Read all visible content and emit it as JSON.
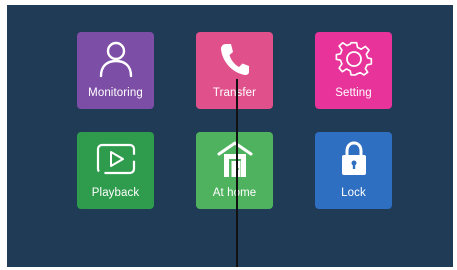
{
  "tiles": {
    "monitoring": {
      "label": "Monitoring",
      "icon": "person-icon",
      "color": "#7d4ea6"
    },
    "transfer": {
      "label": "Transfer",
      "icon": "phone-icon",
      "color": "#e0518c"
    },
    "setting": {
      "label": "Setting",
      "icon": "gear-icon",
      "color": "#e7339a"
    },
    "playback": {
      "label": "Playback",
      "icon": "play-screen-icon",
      "color": "#2f9b4d"
    },
    "athome": {
      "label": "At home",
      "icon": "house-icon",
      "color": "#4fb25e"
    },
    "lock": {
      "label": "Lock",
      "icon": "lock-icon",
      "color": "#2f6fc1"
    }
  },
  "screen_background": "#1f3b55"
}
